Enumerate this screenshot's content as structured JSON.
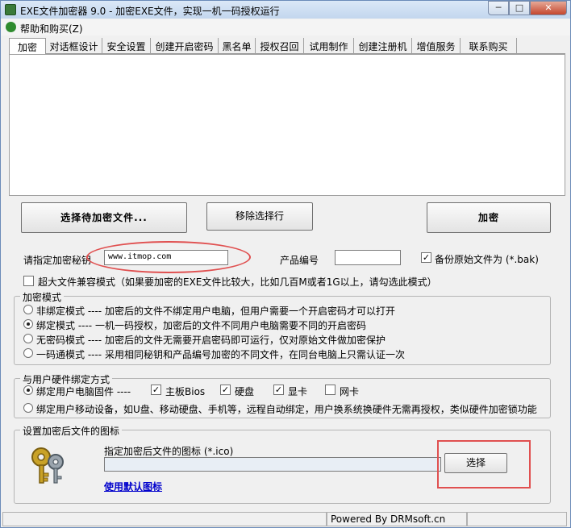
{
  "window": {
    "title": "EXE文件加密器 9.0 - 加密EXE文件，实现一机一码授权运行",
    "min_glyph": "─",
    "max_glyph": "□",
    "close_glyph": "✕"
  },
  "menu": {
    "help_label": "帮助和购买(Z)"
  },
  "tabs": [
    {
      "label": "加密"
    },
    {
      "label": "对话框设计"
    },
    {
      "label": "安全设置"
    },
    {
      "label": "创建开启密码"
    },
    {
      "label": "黑名单"
    },
    {
      "label": "授权召回"
    },
    {
      "label": "试用制作"
    },
    {
      "label": "创建注册机"
    },
    {
      "label": "增值服务"
    },
    {
      "label": "联系购买"
    }
  ],
  "actions": {
    "select_file": "选择待加密文件...",
    "remove_selected": "移除选择行",
    "encrypt": "加密"
  },
  "key_row": {
    "key_label": "请指定加密秘钥",
    "key_value": "www.itmop.com",
    "product_label": "产品编号",
    "product_value": "",
    "backup_label": "备份原始文件为 (*.bak)",
    "backup_checked": "✓"
  },
  "large_file": {
    "label": "超大文件兼容模式（如果要加密的EXE文件比较大，比如几百M或者1G以上，请勾选此模式）"
  },
  "encrypt_mode": {
    "title": "加密模式",
    "options": [
      {
        "label": "非绑定模式 ---- 加密后的文件不绑定用户电脑，但用户需要一个开启密码才可以打开"
      },
      {
        "label": "绑定模式 ---- 一机一码授权，加密后的文件不同用户电脑需要不同的开启密码"
      },
      {
        "label": "无密码模式 ---- 加密后的文件无需要开启密码即可运行，仅对原始文件做加密保护"
      },
      {
        "label": "一码通模式 ---- 采用相同秘钥和产品编号加密的不同文件，在同台电脑上只需认证一次"
      }
    ]
  },
  "hardware": {
    "title": "与用户硬件绑定方式",
    "fixed_label": "绑定用户电脑固件 ----",
    "mainboard": "主板Bios",
    "disk": "硬盘",
    "gpu": "显卡",
    "nic": "网卡",
    "mobile_label": "绑定用户移动设备，如U盘、移动硬盘、手机等，远程自动绑定，用户换系统换硬件无需再授权，类似硬件加密锁功能",
    "check_mark": "✓"
  },
  "icon_group": {
    "title": "设置加密后文件的图标",
    "path_label": "指定加密后文件的图标 (*.ico)",
    "path_value": "",
    "choose": "选择",
    "default_link": "使用默认图标"
  },
  "status": {
    "powered_by": "Powered By DRMsoft.cn"
  }
}
